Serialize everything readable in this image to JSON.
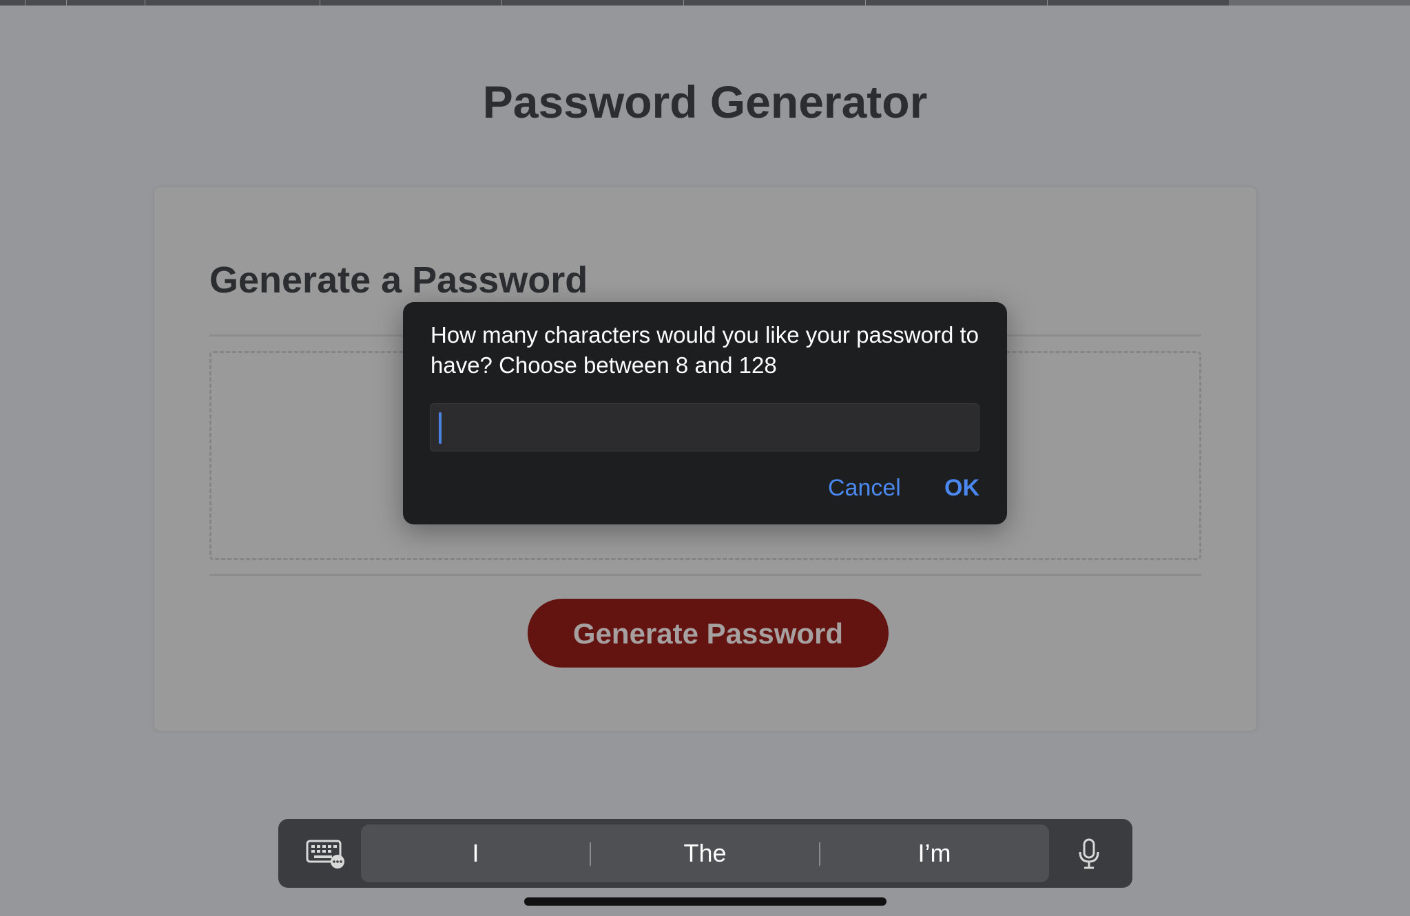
{
  "page": {
    "title": "Password Generator"
  },
  "card": {
    "title": "Generate a Password",
    "generate_button_label": "Generate Password"
  },
  "dialog": {
    "message": "How many characters would you like your password to have? Choose between 8 and 128",
    "input_value": "",
    "cancel_label": "Cancel",
    "ok_label": "OK"
  },
  "keyboard_bar": {
    "suggestions": [
      "I",
      "The",
      "I’m"
    ],
    "left_icon": "keyboard-icon",
    "right_icon": "microphone-icon"
  },
  "colors": {
    "accent": "#4a88f0",
    "button_bg": "#631310",
    "dialog_bg": "#1d1e20"
  }
}
